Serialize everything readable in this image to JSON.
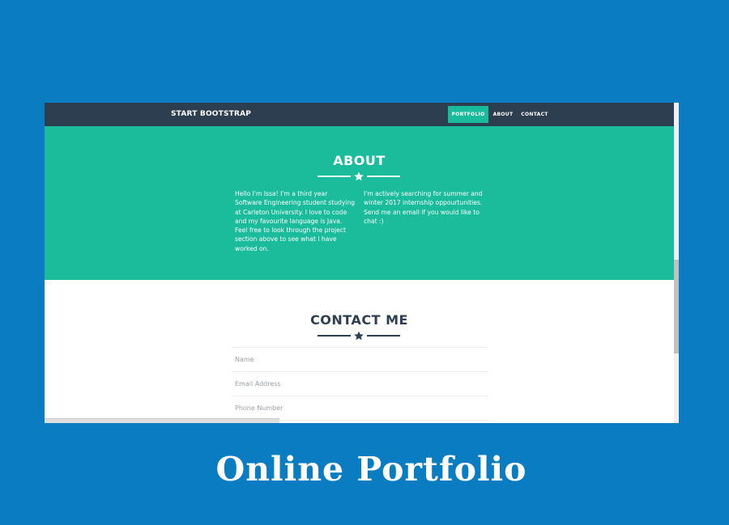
{
  "navbar": {
    "brand": "START BOOTSTRAP",
    "items": [
      {
        "label": "PORTFOLIO",
        "active": true
      },
      {
        "label": "ABOUT",
        "active": false
      },
      {
        "label": "CONTACT",
        "active": false
      }
    ]
  },
  "about": {
    "title": "ABOUT",
    "column_left": "Hello I'm Issa! I'm a third year Software Engineering student studying at Carleton University. I love to code and my favourite language is Java. Feel free to look through the project section above to see what I have worked on.",
    "column_right": "I'm actively searching for summer and winter 2017 internship oppourtunities. Send me an email if you would like to chat :)"
  },
  "contact": {
    "title": "CONTACT ME",
    "fields": [
      {
        "placeholder": "Name"
      },
      {
        "placeholder": "Email Address"
      },
      {
        "placeholder": "Phone Number"
      }
    ]
  },
  "caption": "Online Portfolio",
  "icons": {
    "divider": "star-icon"
  },
  "colors": {
    "navbar": "#2c3e50",
    "accent": "#1abc9c",
    "page_background": "#0a7dc2"
  }
}
